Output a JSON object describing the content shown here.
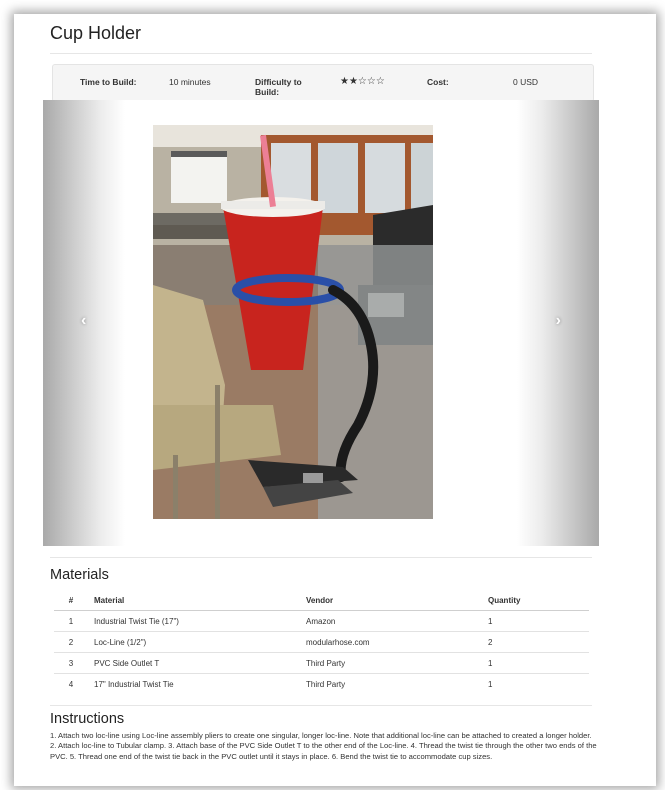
{
  "page": {
    "title": "Cup Holder"
  },
  "info": {
    "time_label": "Time to Build:",
    "time_value": "10 minutes",
    "difficulty_label": "Difficulty to Build:",
    "difficulty_rating": 2,
    "difficulty_max": 5,
    "difficulty_stars": "★★☆☆☆",
    "cost_label": "Cost:",
    "cost_value": "0 USD"
  },
  "carousel": {
    "prev_icon": "chevron-left-icon",
    "next_icon": "chevron-right-icon",
    "prev_glyph": "‹",
    "next_glyph": "›"
  },
  "materials": {
    "heading": "Materials",
    "columns": [
      "#",
      "Material",
      "Vendor",
      "Quantity"
    ],
    "rows": [
      {
        "num": "1",
        "material": "Industrial Twist Tie (17\")",
        "vendor": "Amazon",
        "quantity": "1"
      },
      {
        "num": "2",
        "material": "Loc-Line (1/2\")",
        "vendor": "modularhose.com",
        "quantity": "2"
      },
      {
        "num": "3",
        "material": "PVC Side Outlet T",
        "vendor": "Third Party",
        "quantity": "1"
      },
      {
        "num": "4",
        "material": "17\" Industrial Twist Tie",
        "vendor": "Third Party",
        "quantity": "1"
      }
    ]
  },
  "instructions": {
    "heading": "Instructions",
    "text": "1. Attach two loc-line using Loc-line assembly pliers to create one singular, longer loc-line. Note that additional loc-line can be attached to created a longer holder. 2. Attach loc-line to Tubular clamp. 3. Attach base of the PVC Side Outlet T to the other end of the Loc-line. 4. Thread the twist tie through the other two ends of the PVC. 5. Thread one end of the twist tie back in the PVC outlet until it stays in place. 6. Bend the twist tie to accommodate cup sizes."
  },
  "colors": {
    "cup_red": "#c8241e",
    "twist_tie_blue": "#2a4fa8",
    "loc_line_black": "#1a1a1a"
  }
}
